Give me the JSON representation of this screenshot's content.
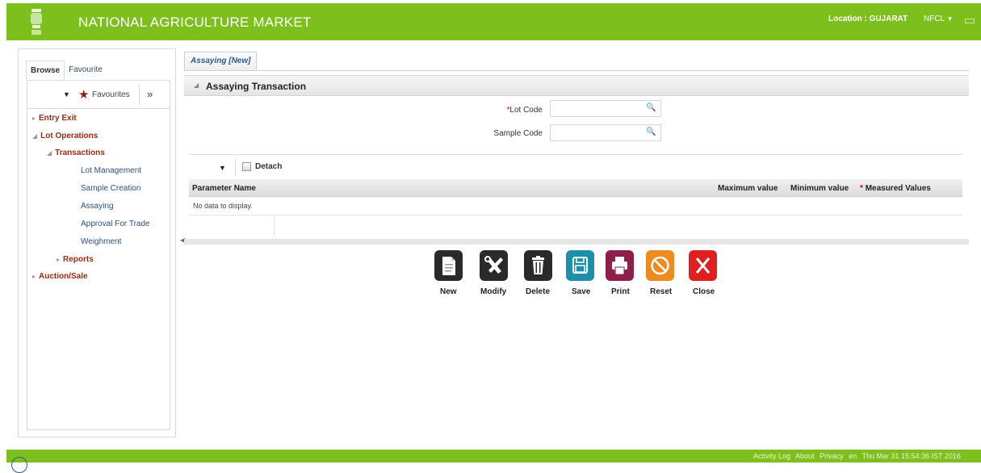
{
  "header": {
    "title": "NATIONAL AGRICULTURE MARKET",
    "location": "Location : GUJARAT",
    "user": "NFCL"
  },
  "left_panel": {
    "tabs": [
      "Browse",
      "Favourite"
    ],
    "favourites_label": "Favourites",
    "tree": {
      "entry_exit": "Entry Exit",
      "lot_operations": "Lot Operations",
      "transactions": "Transactions",
      "lot_management": "Lot Management",
      "sample_creation": "Sample Creation",
      "assaying": "Assaying",
      "approval_for_trade": "Approval For Trade",
      "weighment": "Weighment",
      "reports": "Reports",
      "auction_sale": "Auction/Sale"
    }
  },
  "main": {
    "tab_label": "Assaying [New]",
    "section_title": "Assaying Transaction",
    "form": {
      "lot_code_label": "Lot Code",
      "lot_code_value": "",
      "sample_code_label": "Sample Code",
      "sample_code_value": ""
    },
    "table": {
      "detach_label": "Detach",
      "columns": [
        "Parameter Name",
        "Maximum value",
        "Minimum value",
        "Measured Values"
      ],
      "empty_message": "No data to display."
    },
    "actions": [
      {
        "label": "New",
        "color": "#2a2a2a",
        "icon": "document-icon"
      },
      {
        "label": "Modify",
        "color": "#2a2a2a",
        "icon": "tools-icon"
      },
      {
        "label": "Delete",
        "color": "#2a2a2a",
        "icon": "trash-icon"
      },
      {
        "label": "Save",
        "color": "#1d8fa8",
        "icon": "floppy-icon"
      },
      {
        "label": "Print",
        "color": "#8e1f4a",
        "icon": "printer-icon"
      },
      {
        "label": "Reset",
        "color": "#ec8b1f",
        "icon": "no-entry-icon"
      },
      {
        "label": "Close",
        "color": "#e02020",
        "icon": "x-icon"
      }
    ]
  },
  "footer": {
    "activity_log": "Activity Log",
    "about": "About",
    "privacy": "Privacy",
    "lang": "en",
    "timestamp": "Thu Mar 31 15:54:36 IST 2016"
  },
  "colors": {
    "brand_green": "#7dc01e",
    "tree_bold": "#9a2a12",
    "link_blue": "#2d4f7a"
  }
}
